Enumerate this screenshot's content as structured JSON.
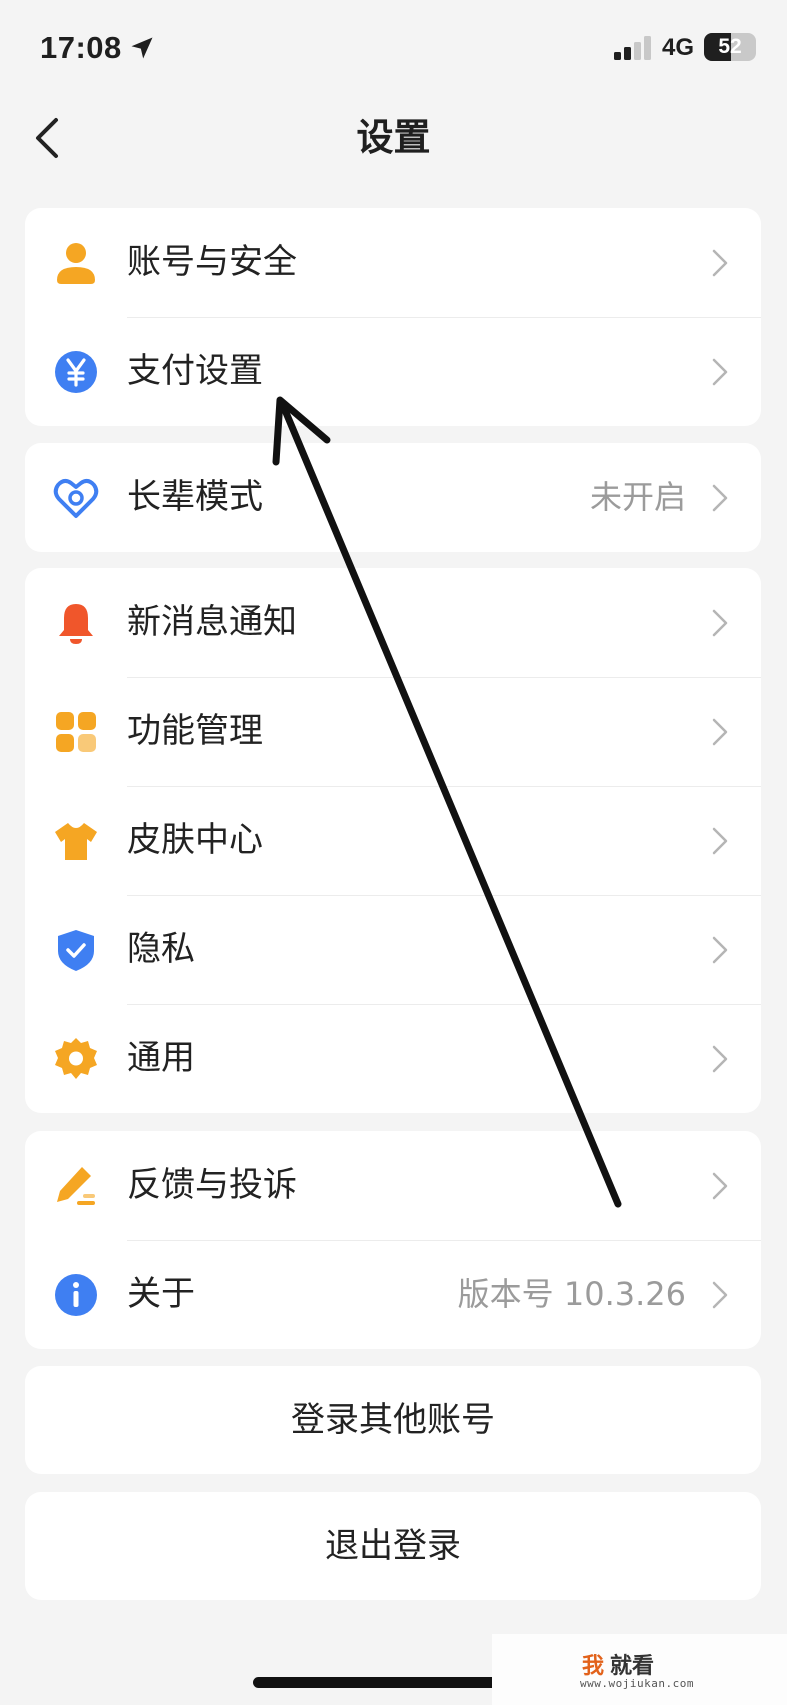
{
  "status_bar": {
    "time": "17:08",
    "network": "4G",
    "battery": "52",
    "battery_level": 0.52
  },
  "header": {
    "title": "设置"
  },
  "groups": [
    {
      "items": [
        {
          "label": "账号与安全",
          "value": "",
          "icon": "user-icon",
          "color": "#f5a623"
        },
        {
          "label": "支付设置",
          "value": "",
          "icon": "yuan-icon",
          "color": "#3f7ff2"
        }
      ]
    },
    {
      "items": [
        {
          "label": "长辈模式",
          "value": "未开启",
          "icon": "heart-icon",
          "color": "#3f7ff2"
        }
      ]
    },
    {
      "items": [
        {
          "label": "新消息通知",
          "value": "",
          "icon": "bell-icon",
          "color": "#f0562b"
        },
        {
          "label": "功能管理",
          "value": "",
          "icon": "grid-icon",
          "color": "#f5a623"
        },
        {
          "label": "皮肤中心",
          "value": "",
          "icon": "shirt-icon",
          "color": "#f5a623"
        },
        {
          "label": "隐私",
          "value": "",
          "icon": "shield-icon",
          "color": "#3f7ff2"
        },
        {
          "label": "通用",
          "value": "",
          "icon": "gear-icon",
          "color": "#f5a623"
        }
      ]
    },
    {
      "items": [
        {
          "label": "反馈与投诉",
          "value": "",
          "icon": "pencil-icon",
          "color": "#f5a623"
        },
        {
          "label": "关于",
          "value": "版本号 10.3.26",
          "icon": "info-icon",
          "color": "#3f7ff2"
        }
      ]
    }
  ],
  "actions": {
    "switch_account": "登录其他账号",
    "logout": "退出登录"
  },
  "watermark": {
    "char1": "我",
    "char2": "就看",
    "url": "www.wojiukan.com"
  }
}
